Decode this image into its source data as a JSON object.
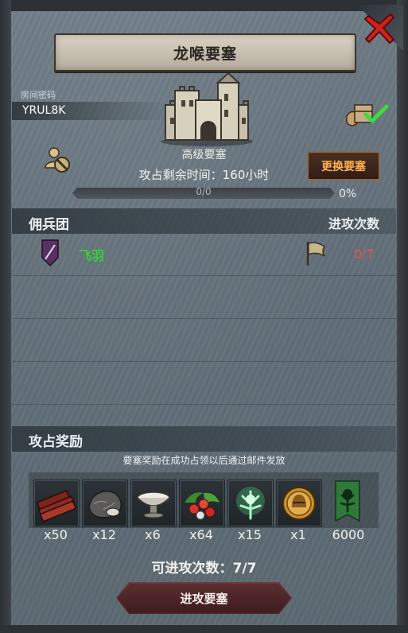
{
  "title": "龙喉要塞",
  "room": {
    "label": "房间密码",
    "code": "YRUL8K"
  },
  "fortress": {
    "name": "高级要塞",
    "attack_time_text": "攻占剩余时间：160小时",
    "change_button": "更换要塞",
    "progress_text": "0/0",
    "progress_percent_text": "0%",
    "progress_value": 0
  },
  "mercenary": {
    "section_title": "佣兵团",
    "attack_count_title": "进攻次数",
    "rows": [
      {
        "name": "飞羽",
        "count": "0/7"
      }
    ]
  },
  "rewards": {
    "section_title": "攻占奖励",
    "subtitle": "要塞奖励在成功占领以后通过邮件发放",
    "items": [
      {
        "icon": "timber-icon",
        "qty": "x50"
      },
      {
        "icon": "stone-icon",
        "qty": "x12"
      },
      {
        "icon": "grain-bowl-icon",
        "qty": "x6"
      },
      {
        "icon": "berries-icon",
        "qty": "x64"
      },
      {
        "icon": "magic-tree-icon",
        "qty": "x15"
      },
      {
        "icon": "knight-helmet-coin-icon",
        "qty": "x1"
      },
      {
        "icon": "guild-banner-icon",
        "qty": "6000"
      }
    ]
  },
  "attack_remaining_text": "可进攻次数：7/7",
  "attack_button": "进攻要塞",
  "colors": {
    "green_name": "#2fd631",
    "red_count": "#e45555",
    "orange_button_text": "#ffb04a",
    "close_red": "#d3201b"
  }
}
